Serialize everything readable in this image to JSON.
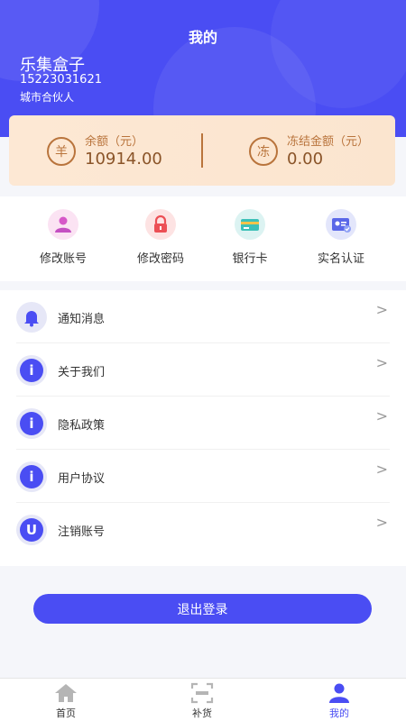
{
  "page": {
    "title": "我的"
  },
  "user": {
    "name": "乐集盒子",
    "phone": "15223031621",
    "role": "城市合伙人"
  },
  "wallet": {
    "balance": {
      "icon": "yang-coin-icon",
      "icon_char": "羊",
      "label": "余额（元）",
      "value": "10914.00"
    },
    "frozen": {
      "icon": "dong-coin-icon",
      "icon_char": "冻",
      "label": "冻结金额（元）",
      "value": "0.00"
    }
  },
  "quick_actions": [
    {
      "label": "修改账号",
      "icon": "user-icon"
    },
    {
      "label": "修改密码",
      "icon": "lock-icon"
    },
    {
      "label": "银行卡",
      "icon": "bank-card-icon"
    },
    {
      "label": "实名认证",
      "icon": "id-card-icon"
    }
  ],
  "menu": [
    {
      "label": "通知消息",
      "icon": "bell-icon"
    },
    {
      "label": "关于我们",
      "icon": "info-icon",
      "icon_char": "i"
    },
    {
      "label": "隐私政策",
      "icon": "info-icon",
      "icon_char": "i"
    },
    {
      "label": "用户协议",
      "icon": "info-icon",
      "icon_char": "i"
    },
    {
      "label": "注销账号",
      "icon": "power-icon",
      "icon_char": "U"
    }
  ],
  "logout_label": "退出登录",
  "tabs": [
    {
      "label": "首页",
      "icon": "home-icon"
    },
    {
      "label": "补货",
      "icon": "scan-icon"
    },
    {
      "label": "我的",
      "icon": "profile-icon",
      "active": true
    }
  ],
  "colors": {
    "primary": "#4a4df3",
    "wallet_text": "#b9743c",
    "wallet_bg": "#fde8d4"
  }
}
